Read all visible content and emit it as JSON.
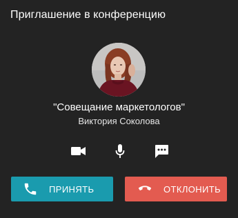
{
  "dialog": {
    "title": "Приглашение в конференцию",
    "conference_name": "\"Совещание маркетологов\"",
    "caller_name": "Виктория Соколова"
  },
  "controls": [
    {
      "icon": "video-camera-icon"
    },
    {
      "icon": "microphone-icon"
    },
    {
      "icon": "chat-icon"
    }
  ],
  "buttons": {
    "accept_label": "ПРИНЯТЬ",
    "decline_label": "ОТКЛОНИТЬ"
  },
  "colors": {
    "background": "#232323",
    "accept": "#1a9bae",
    "decline": "#e35b50"
  }
}
